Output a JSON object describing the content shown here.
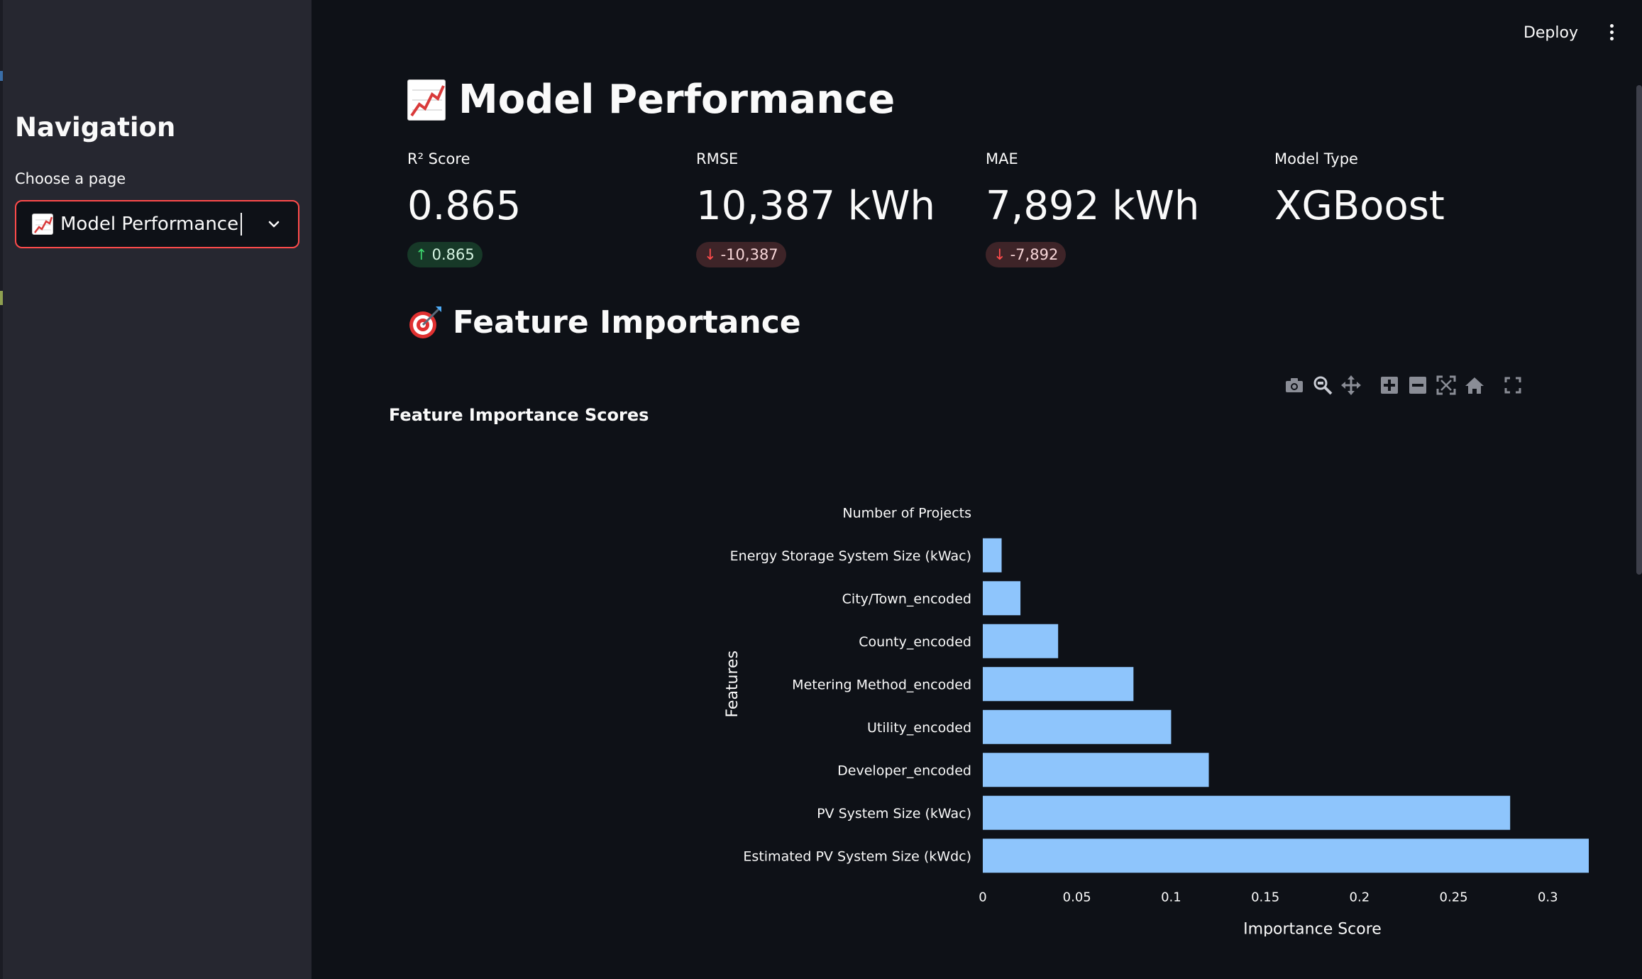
{
  "header": {
    "deploy_label": "Deploy",
    "menu_icon": "more-vertical-icon"
  },
  "sidebar": {
    "title": "Navigation",
    "select_label": "Choose a page",
    "select_value": "Model Performance",
    "select_icon": "chart-increasing-icon"
  },
  "main": {
    "title": "Model Performance",
    "metrics": [
      {
        "label": "R² Score",
        "value": "0.865",
        "delta": "0.865",
        "delta_direction": "up"
      },
      {
        "label": "RMSE",
        "value": "10,387 kWh",
        "delta": "-10,387",
        "delta_direction": "down"
      },
      {
        "label": "MAE",
        "value": "7,892 kWh",
        "delta": "-7,892",
        "delta_direction": "down"
      },
      {
        "label": "Model Type",
        "value": "XGBoost"
      }
    ],
    "section_title": "Feature Importance",
    "section_icon": "target-icon"
  },
  "chart_toolbar": [
    "camera-icon",
    "zoom-icon",
    "pan-icon",
    "zoom-in-icon",
    "zoom-out-icon",
    "autoscale-icon",
    "reset-axes-icon",
    "fullscreen-icon"
  ],
  "colors": {
    "background": "#0e1117",
    "sidebar": "#262730",
    "accent": "#ff4b4b",
    "bar": "#83c9ff",
    "delta_up": "#3dd56d",
    "delta_down": "#ff4b4b"
  },
  "chart_data": {
    "type": "bar",
    "orientation": "horizontal",
    "title": "Feature Importance Scores",
    "xlabel": "Importance Score",
    "ylabel": "Features",
    "categories": [
      "Number of Projects",
      "Energy Storage System Size (kWac)",
      "City/Town_encoded",
      "County_encoded",
      "Metering Method_encoded",
      "Utility_encoded",
      "Developer_encoded",
      "PV System Size (kWac)",
      "Estimated PV System Size (kWdc)"
    ],
    "values": [
      0,
      0.01,
      0.02,
      0.04,
      0.08,
      0.1,
      0.12,
      0.28,
      0.35
    ],
    "xlim": [
      0,
      0.35
    ],
    "xticks": [
      "0",
      "0.05",
      "0.1",
      "0.15",
      "0.2",
      "0.25",
      "0.3",
      "0.35"
    ],
    "tick_values": [
      0,
      0.05,
      0.1,
      0.15,
      0.2,
      0.25,
      0.3,
      0.35
    ],
    "grid": false,
    "legend": false
  }
}
